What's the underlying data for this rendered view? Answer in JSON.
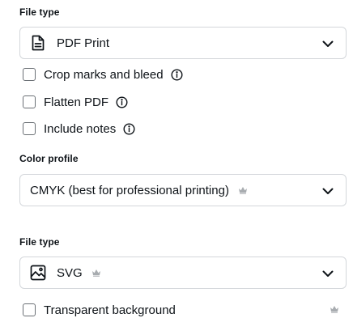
{
  "file_type_section": {
    "label": "File type",
    "selected": "PDF Print",
    "selected_icon": "document-icon"
  },
  "options": [
    {
      "label": "Crop marks and bleed",
      "checked": false,
      "icon": "info-icon"
    },
    {
      "label": "Flatten PDF",
      "checked": false,
      "icon": "info-icon"
    },
    {
      "label": "Include notes",
      "checked": false,
      "icon": "info-icon"
    }
  ],
  "color_profile": {
    "label": "Color profile",
    "selected": "CMYK (best for professional printing)",
    "badge_icon": "crown-icon"
  },
  "file_type_section_2": {
    "label": "File type",
    "selected": "SVG",
    "selected_icon": "image-icon",
    "badge_icon": "crown-icon"
  },
  "transparent": {
    "label": "Transparent background",
    "checked": false,
    "badge_icon": "crown-icon"
  },
  "colors": {
    "text": "#0e1318",
    "border": "#d4d7db",
    "crown": "#a8acb0"
  }
}
